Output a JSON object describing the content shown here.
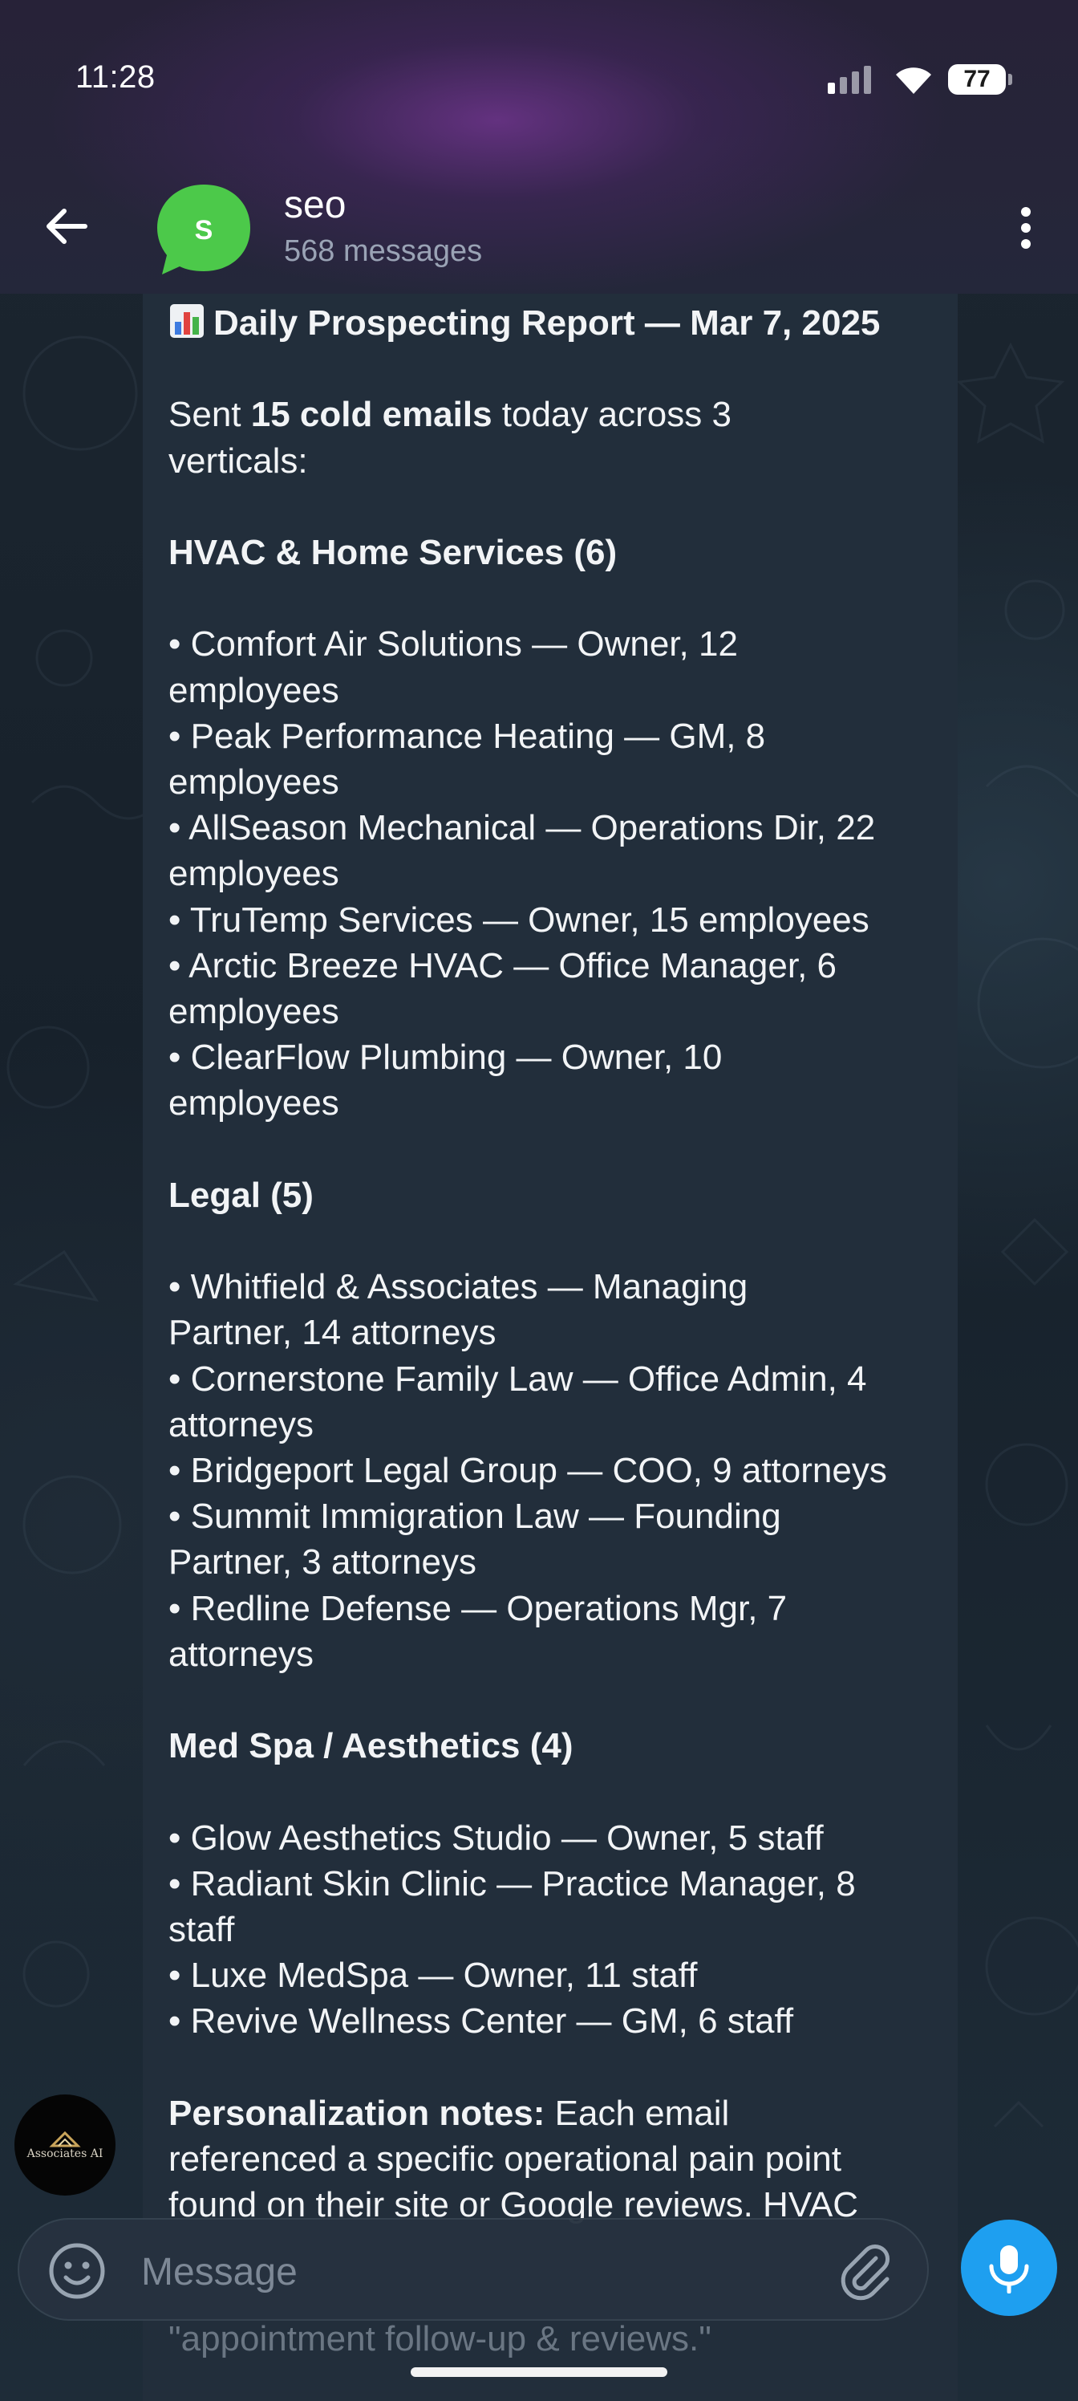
{
  "status_bar": {
    "time": "11:28",
    "battery": "77"
  },
  "header": {
    "avatar_letter": "S",
    "title": "seo",
    "subtitle": "568 messages"
  },
  "message": {
    "lines": [
      {
        "segments": [
          {
            "text": "Daily Prospecting Report — Mar 7, 2025",
            "bold": true
          }
        ],
        "icon": "bar-chart-icon"
      },
      {
        "segments": []
      },
      {
        "segments": [
          {
            "text": "Sent "
          },
          {
            "text": "15 cold emails",
            "bold": true
          },
          {
            "text": " today across 3"
          }
        ]
      },
      {
        "segments": [
          {
            "text": "verticals:"
          }
        ]
      },
      {
        "segments": []
      },
      {
        "segments": [
          {
            "text": "HVAC & Home Services (6)",
            "bold": true
          }
        ]
      },
      {
        "segments": []
      },
      {
        "segments": [
          {
            "text": "• Comfort Air Solutions — Owner, 12"
          }
        ]
      },
      {
        "segments": [
          {
            "text": "employees"
          }
        ]
      },
      {
        "segments": [
          {
            "text": "• Peak Performance Heating — GM, 8"
          }
        ]
      },
      {
        "segments": [
          {
            "text": "employees"
          }
        ]
      },
      {
        "segments": [
          {
            "text": "• AllSeason Mechanical — Operations Dir, 22"
          }
        ]
      },
      {
        "segments": [
          {
            "text": "employees"
          }
        ]
      },
      {
        "segments": [
          {
            "text": "• TruTemp Services — Owner, 15 employees"
          }
        ]
      },
      {
        "segments": [
          {
            "text": "• Arctic Breeze HVAC — Office Manager, 6"
          }
        ]
      },
      {
        "segments": [
          {
            "text": "employees"
          }
        ]
      },
      {
        "segments": [
          {
            "text": "• ClearFlow Plumbing — Owner, 10"
          }
        ]
      },
      {
        "segments": [
          {
            "text": "employees"
          }
        ]
      },
      {
        "segments": []
      },
      {
        "segments": [
          {
            "text": "Legal (5)",
            "bold": true
          }
        ]
      },
      {
        "segments": []
      },
      {
        "segments": [
          {
            "text": "• Whitfield & Associates — Managing"
          }
        ]
      },
      {
        "segments": [
          {
            "text": "Partner, 14 attorneys"
          }
        ]
      },
      {
        "segments": [
          {
            "text": "• Cornerstone Family Law — Office Admin, 4"
          }
        ]
      },
      {
        "segments": [
          {
            "text": "attorneys"
          }
        ]
      },
      {
        "segments": [
          {
            "text": "• Bridgeport Legal Group — COO, 9 attorneys"
          }
        ]
      },
      {
        "segments": [
          {
            "text": "• Summit Immigration Law — Founding"
          }
        ]
      },
      {
        "segments": [
          {
            "text": "Partner, 3 attorneys"
          }
        ]
      },
      {
        "segments": [
          {
            "text": "• Redline Defense — Operations Mgr, 7"
          }
        ]
      },
      {
        "segments": [
          {
            "text": "attorneys"
          }
        ]
      },
      {
        "segments": []
      },
      {
        "segments": [
          {
            "text": "Med Spa / Aesthetics (4)",
            "bold": true
          }
        ]
      },
      {
        "segments": []
      },
      {
        "segments": [
          {
            "text": "• Glow Aesthetics Studio — Owner, 5 staff"
          }
        ]
      },
      {
        "segments": [
          {
            "text": "• Radiant Skin Clinic — Practice Manager, 8"
          }
        ]
      },
      {
        "segments": [
          {
            "text": "staff"
          }
        ]
      },
      {
        "segments": [
          {
            "text": "• Luxe MedSpa — Owner, 11 staff"
          }
        ]
      },
      {
        "segments": [
          {
            "text": "• Revive Wellness Center — GM, 6 staff"
          }
        ]
      },
      {
        "segments": []
      },
      {
        "segments": [
          {
            "text": "Personalization notes:",
            "bold": true
          },
          {
            "text": " Each email"
          }
        ]
      },
      {
        "segments": [
          {
            "text": "referenced a specific operational pain point"
          }
        ]
      },
      {
        "segments": [
          {
            "text": "found on their site or Google reviews. HVAC"
          }
        ]
      }
    ],
    "overflow_line": "\"appointment follow-up & reviews.\""
  },
  "bot_avatar_label": "Associates AI",
  "composer": {
    "placeholder": "Message"
  },
  "colors": {
    "accent": "#1e9ff0",
    "avatar_green": "#4cc94a",
    "bubble": "#222e3b"
  }
}
